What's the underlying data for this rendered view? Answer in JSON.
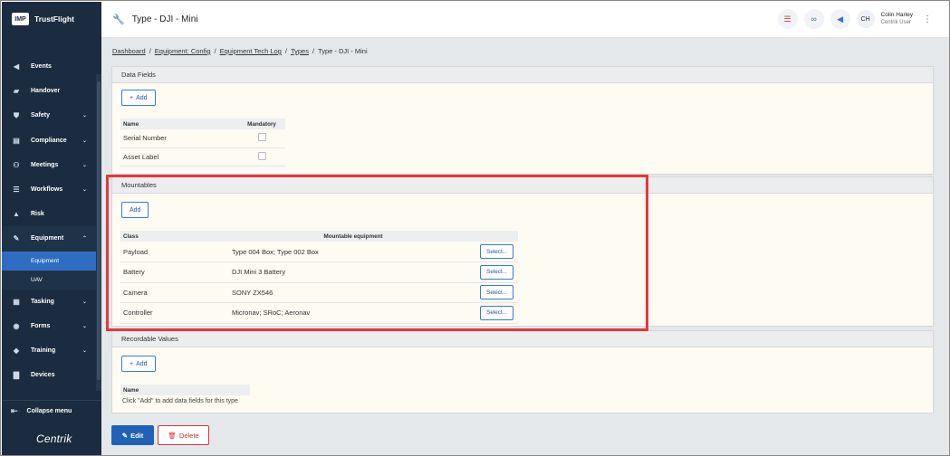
{
  "brand": {
    "logo": "IMP",
    "name": "TrustFlight"
  },
  "sidebar": {
    "items": [
      {
        "icon": "megaphone-icon",
        "glyph": "◀",
        "label": "Events",
        "chevron": false
      },
      {
        "icon": "handover-icon",
        "glyph": "▰",
        "label": "Handover",
        "chevron": false
      },
      {
        "icon": "shield-icon",
        "glyph": "⛊",
        "label": "Safety",
        "chevron": true
      },
      {
        "icon": "clipboard-icon",
        "glyph": "▤",
        "label": "Compliance",
        "chevron": true
      },
      {
        "icon": "meetings-icon",
        "glyph": "⚇",
        "label": "Meetings",
        "chevron": true
      },
      {
        "icon": "workflow-icon",
        "glyph": "☰",
        "label": "Workflows",
        "chevron": true
      },
      {
        "icon": "warning-icon",
        "glyph": "▲",
        "label": "Risk",
        "chevron": false
      },
      {
        "icon": "wrench-icon",
        "glyph": "✎",
        "label": "Equipment",
        "chevron": true,
        "open": true
      }
    ],
    "equipment_sub": [
      {
        "label": "Equipment",
        "active": true
      },
      {
        "label": "UAV",
        "active": false
      }
    ],
    "items_after": [
      {
        "icon": "tasking-icon",
        "glyph": "▦",
        "label": "Tasking",
        "chevron": true
      },
      {
        "icon": "forms-icon",
        "glyph": "◉",
        "label": "Forms",
        "chevron": true
      },
      {
        "icon": "graduation-cap-icon",
        "glyph": "◆",
        "label": "Training",
        "chevron": true
      },
      {
        "icon": "devices-icon",
        "glyph": "▇",
        "label": "Devices",
        "chevron": false
      }
    ],
    "collapse_label": "Collapse menu",
    "footer_logo": "Centrik"
  },
  "header": {
    "title": "Type - DJI - Mini",
    "user_initials": "CH",
    "user_name": "Colin Harley",
    "user_role": "Centrik User"
  },
  "breadcrumb": {
    "items": [
      "Dashboard",
      "Equipment: Config",
      "Equipment Tech Log",
      "Types"
    ],
    "current": "Type - DJI - Mini",
    "separator": "/"
  },
  "data_fields": {
    "title": "Data Fields",
    "add_label": "Add",
    "col_name": "Name",
    "col_mandatory": "Mandatory",
    "rows": [
      {
        "name": "Serial Number",
        "mandatory": false
      },
      {
        "name": "Asset Label",
        "mandatory": false
      }
    ]
  },
  "mountables": {
    "title": "Mountables",
    "add_label": "Add",
    "col_class": "Class",
    "col_equipment": "Mountable equipment",
    "select_label": "Select...",
    "rows": [
      {
        "class": "Payload",
        "equipment": "Type 004 Box; Type 002 Box"
      },
      {
        "class": "Battery",
        "equipment": "DJI Mini 3 Battery"
      },
      {
        "class": "Camera",
        "equipment": "SONY ZX546"
      },
      {
        "class": "Controller",
        "equipment": "Micronav; SRoC; Aeronav"
      }
    ]
  },
  "recordable": {
    "title": "Recordable Values",
    "add_label": "Add",
    "col_name": "Name",
    "empty_message": "Click \"Add\" to add data fields for this type"
  },
  "actions": {
    "edit_label": "Edit",
    "delete_label": "Delete"
  },
  "colors": {
    "sidebar_bg": "#1b2c40",
    "accent": "#1f63b8",
    "danger": "#c8383e",
    "highlight": "#e8363b"
  }
}
